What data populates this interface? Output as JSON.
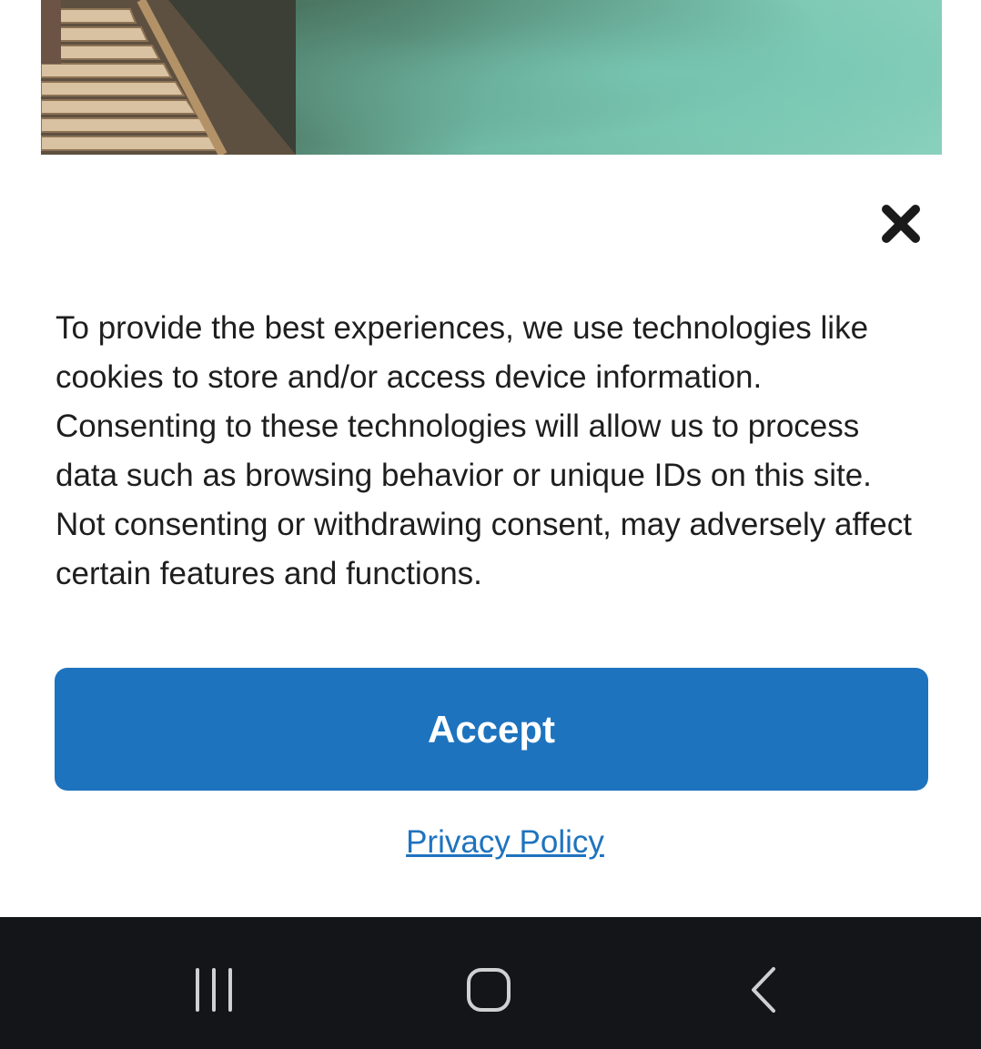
{
  "consent": {
    "close_icon": "close-icon",
    "message": "To provide the best experiences, we use technologies like cookies to store and/or access device information. Consenting to these technologies will allow us to process data such as browsing behavior or unique IDs on this site. Not consenting or withdrawing consent, may adversely affect certain features and functions.",
    "accept_label": "Accept",
    "privacy_label": "Privacy Policy",
    "accent_color": "#1e73be"
  },
  "nav_bar": {
    "recents_icon": "recent-apps-icon",
    "home_icon": "home-icon",
    "back_icon": "back-icon",
    "background_color": "#141518"
  }
}
